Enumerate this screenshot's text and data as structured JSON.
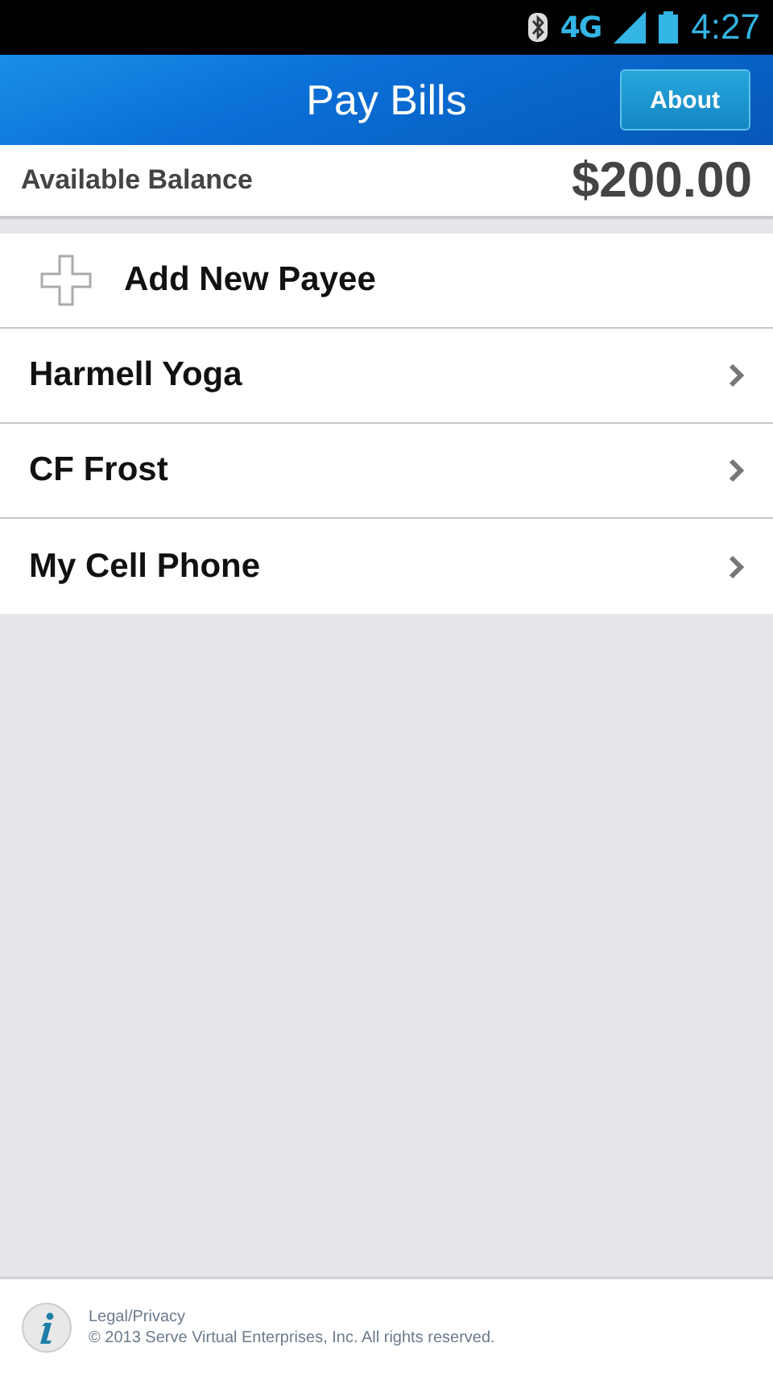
{
  "status_bar": {
    "network": "4G",
    "time": "4:27"
  },
  "header": {
    "title": "Pay Bills",
    "button": "About"
  },
  "balance": {
    "label": "Available Balance",
    "amount": "$200.00"
  },
  "add_payee": {
    "label": "Add New Payee"
  },
  "payees": [
    {
      "name": "Harmell Yoga"
    },
    {
      "name": "CF Frost"
    },
    {
      "name": "My Cell Phone"
    }
  ],
  "footer": {
    "link": "Legal/Privacy",
    "copyright": "© 2013 Serve Virtual Enterprises, Inc. All rights reserved."
  }
}
